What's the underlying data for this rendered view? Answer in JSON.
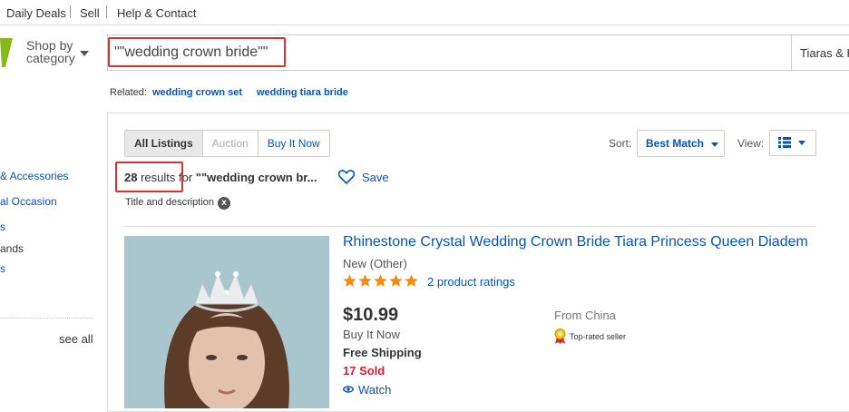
{
  "topnav": {
    "daily_deals": "Daily Deals",
    "sell": "Sell",
    "help": "Help & Contact"
  },
  "header": {
    "shop_by_line1": "Shop by",
    "shop_by_line2": "category",
    "search_value": "\"\"wedding crown bride\"\"",
    "category_select": "Tiaras & H"
  },
  "related": {
    "label": "Related:",
    "links": [
      "wedding crown set",
      "wedding tiara bride"
    ]
  },
  "sidebar": {
    "items": [
      "& Accessories",
      "al Occasion",
      "s",
      "ands",
      "s"
    ],
    "see_all": "see all"
  },
  "results": {
    "tabs": [
      "All Listings",
      "Auction",
      "Buy It Now"
    ],
    "sort_label": "Sort:",
    "sort_value": "Best Match",
    "view_label": "View:",
    "count": "28",
    "count_suffix": " results",
    "count_for": " for ",
    "query_trunc": "\"\"wedding crown br...",
    "save_label": "Save",
    "filter_chip": "Title and description",
    "filter_clear": "x"
  },
  "listing": {
    "title": "Rhinestone Crystal Wedding Crown Bride Tiara Princess Queen Diadem",
    "condition": "New (Other)",
    "rating_stars": 5,
    "ratings_text": "2 product ratings",
    "price": "$10.99",
    "buy_type": "Buy It Now",
    "shipping": "Free Shipping",
    "sold": "17 Sold",
    "watch": "Watch",
    "location": "From China",
    "seller_badge": "Top-rated seller"
  },
  "colors": {
    "link": "#0654ba",
    "highlight": "#d9302c",
    "sold": "#dd1e31",
    "star": "#f18c0e"
  }
}
